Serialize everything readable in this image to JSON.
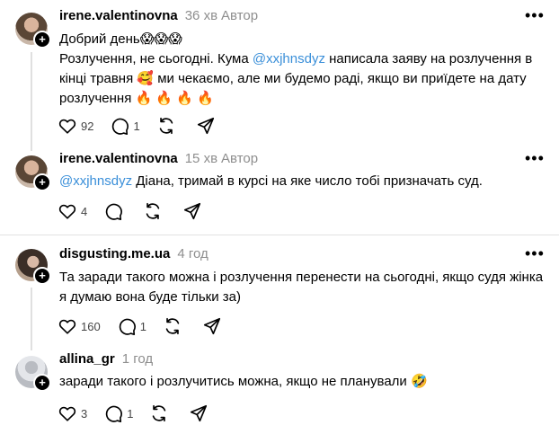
{
  "posts": [
    {
      "username": "irene.valentinovna",
      "time": "36 хв",
      "author": "Автор",
      "lines": [
        "Добрий день😱😱😱"
      ],
      "line2_pre": "Розлучення, не сьогодні. Кума ",
      "mention": "@xxjhnsdyz",
      "line2_post": " написала заяву на розлучення в",
      "line3": "кінці травня 🥰 ми чекаємо, але ми будемо раді, якщо ви приїдете на дату",
      "line4": "розлучення 🔥 🔥 🔥 🔥",
      "likes": "92",
      "comments": "1"
    },
    {
      "username": "irene.valentinovna",
      "time": "15 хв",
      "author": "Автор",
      "mention": "@xxjhnsdyz",
      "text": " Діана, тримай в курсі на яке число тобі призначать суд.",
      "likes": "4",
      "comments": ""
    },
    {
      "username": "disgusting.me.ua",
      "time": "4 год",
      "line1": "Та заради такого можна і розлучення перенести на сьогодні, якщо судя жінка",
      "line2": "я думаю вона буде тільки за)",
      "likes": "160",
      "comments": "1"
    },
    {
      "username": "allina_gr",
      "time": "1 год",
      "text": "заради такого і розлучитись можна, якщо не планували 🤣",
      "likes": "3",
      "comments": "1"
    }
  ],
  "icons": {
    "more": "more-icon",
    "like": "heart-icon",
    "comment": "comment-icon",
    "repost": "repost-icon",
    "share": "share-icon"
  },
  "colors": {
    "mention": "#3a8fd9",
    "muted": "#8e8e8e",
    "divider": "#e2e2e2"
  }
}
